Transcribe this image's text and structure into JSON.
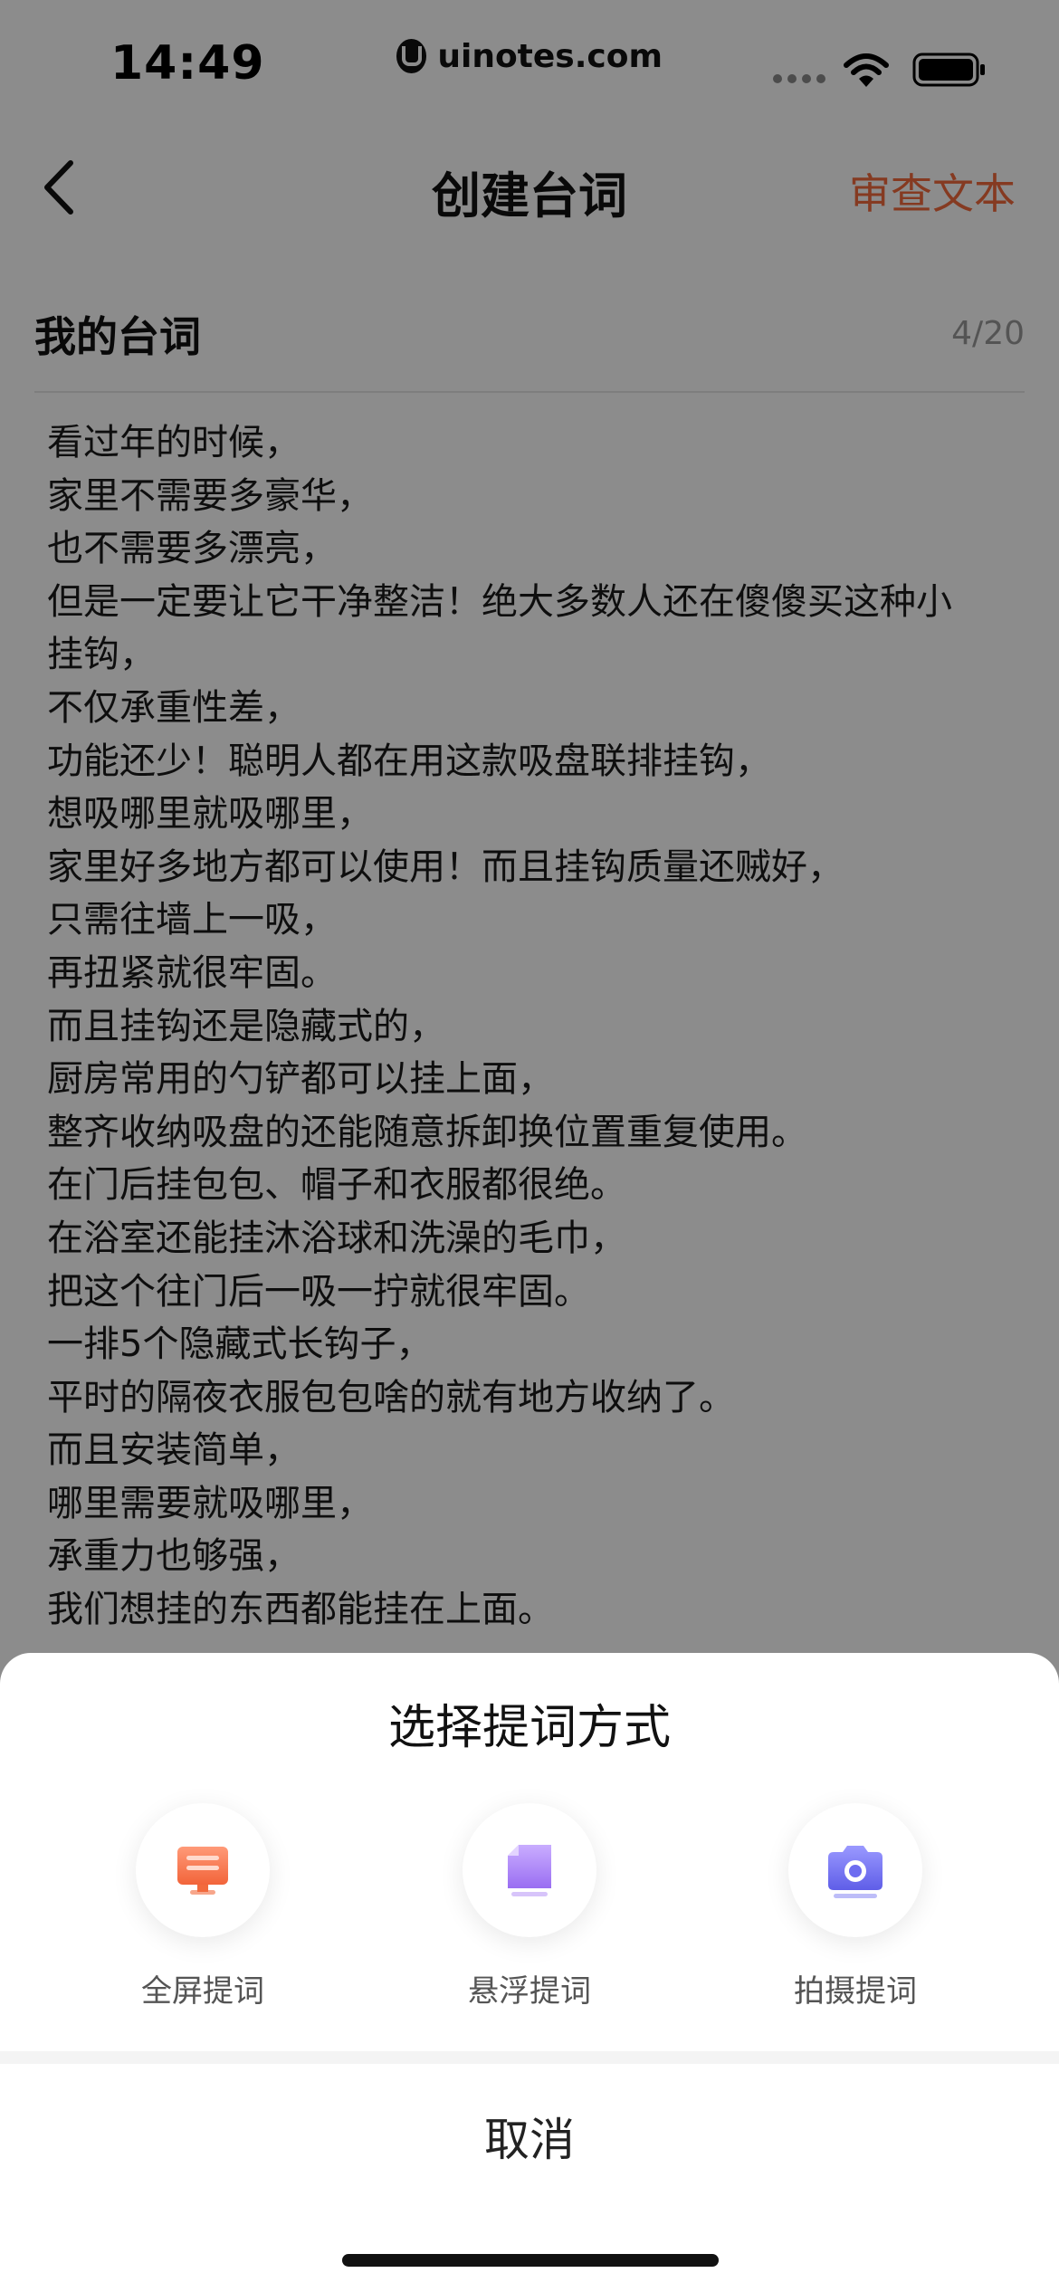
{
  "status_bar": {
    "time": "14:49",
    "watermark": "uinotes.com"
  },
  "nav": {
    "title": "创建台词",
    "review_label": "审查文本"
  },
  "script": {
    "title": "我的台词",
    "count": "4/20",
    "lines": [
      "看过年的时候，",
      "家里不需要多豪华，",
      "也不需要多漂亮，",
      "但是一定要让它干净整洁！绝大多数人还在傻傻买这种小",
      "挂钩，",
      "不仅承重性差，",
      "功能还少！聪明人都在用这款吸盘联排挂钩，",
      "想吸哪里就吸哪里，",
      "家里好多地方都可以使用！而且挂钩质量还贼好，",
      "只需往墙上一吸，",
      "再扭紧就很牢固。",
      "而且挂钩还是隐藏式的，",
      "厨房常用的勺铲都可以挂上面，",
      "整齐收纳吸盘的还能随意拆卸换位置重复使用。",
      "在门后挂包包、帽子和衣服都很绝。",
      "在浴室还能挂沐浴球和洗澡的毛巾，",
      "把这个往门后一吸一拧就很牢固。",
      "一排5个隐藏式长钩子，",
      "平时的隔夜衣服包包啥的就有地方收纳了。",
      "而且安装简单，",
      "哪里需要就吸哪里，",
      "承重力也够强，",
      "我们想挂的东西都能挂在上面。"
    ]
  },
  "sheet": {
    "title": "选择提词方式",
    "options": [
      {
        "label": "全屏提词",
        "icon": "fullscreen-prompt-icon",
        "color": "#f26a3d"
      },
      {
        "label": "悬浮提词",
        "icon": "floating-prompt-icon",
        "color": "#a67cf5"
      },
      {
        "label": "拍摄提词",
        "icon": "camera-prompt-icon",
        "color": "#6d6cf0"
      }
    ],
    "cancel_label": "取消"
  }
}
